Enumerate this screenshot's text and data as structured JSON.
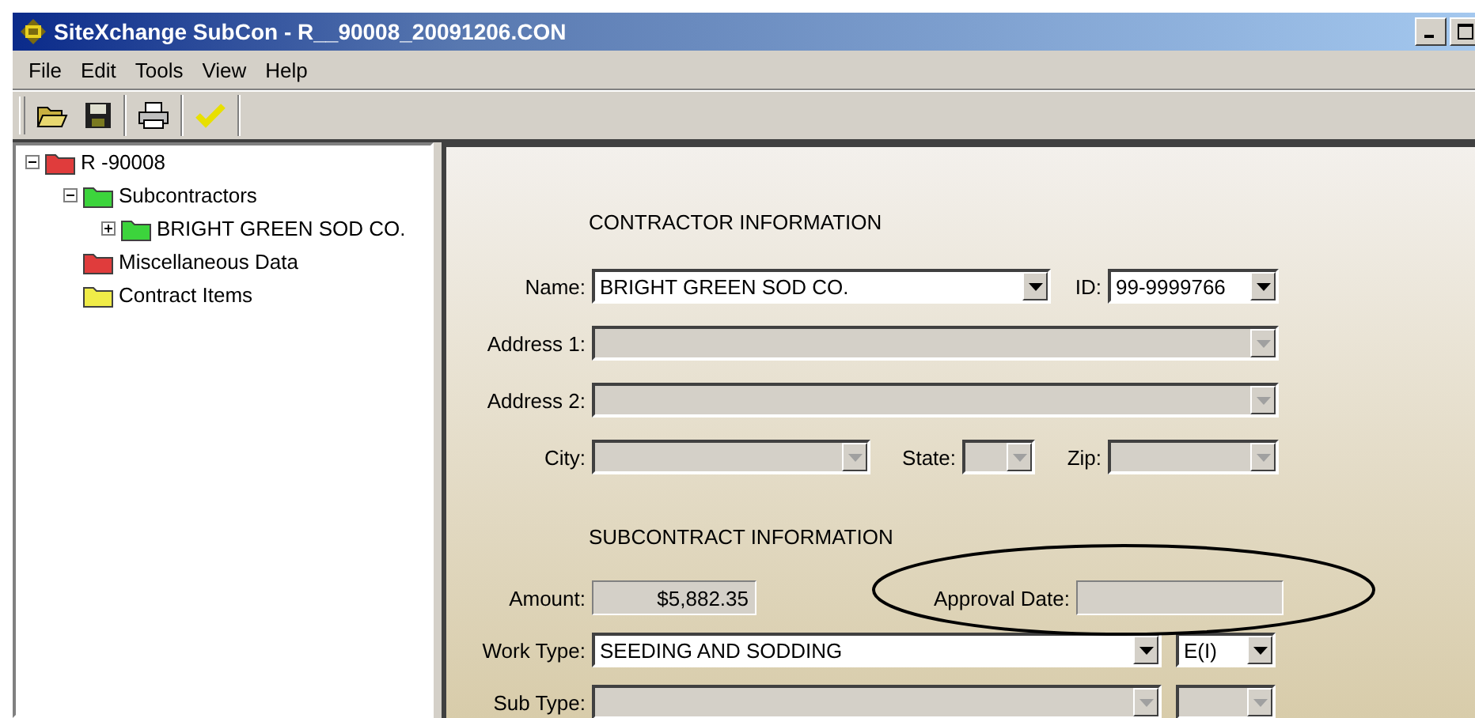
{
  "window": {
    "title": "SiteXchange SubCon - R__90008_20091206.CON"
  },
  "menu": [
    {
      "label": "File"
    },
    {
      "label": "Edit"
    },
    {
      "label": "Tools"
    },
    {
      "label": "View"
    },
    {
      "label": "Help"
    }
  ],
  "tree": [
    {
      "label": "R -90008",
      "color": "#e03c3c",
      "expanded": true,
      "children": [
        {
          "label": "Subcontractors",
          "color": "#3cd43c",
          "expanded": true,
          "children": [
            {
              "label": "BRIGHT GREEN SOD CO.",
              "color": "#3cd43c",
              "expanded": false
            }
          ]
        },
        {
          "label": "Miscellaneous Data",
          "color": "#e03c3c"
        },
        {
          "label": "Contract Items",
          "color": "#f0ec48"
        }
      ]
    }
  ],
  "contractor": {
    "title": "CONTRACTOR INFORMATION",
    "name": {
      "label": "Name:",
      "value": "BRIGHT GREEN SOD CO.",
      "disabled": false
    },
    "id": {
      "label": "ID:",
      "value": "99-9999766",
      "disabled": false
    },
    "address_1": {
      "label": "Address 1:",
      "disabled": true
    },
    "address_2": {
      "label": "Address 2:",
      "disabled": true
    },
    "city": {
      "label": "City:",
      "disabled": true
    },
    "state": {
      "label": "State:",
      "disabled": true
    },
    "zip": {
      "label": "Zip:",
      "disabled": true
    }
  },
  "subcontract": {
    "title": "SUBCONTRACT INFORMATION",
    "amount": {
      "label": "Amount:",
      "value": "$5,882.35"
    },
    "approval_date": {
      "label": "Approval Date:"
    },
    "work_type": {
      "label": "Work Type:",
      "value": "SEEDING AND SODDING",
      "disabled": false
    },
    "work_type_code": {
      "value": "E(I)",
      "disabled": false
    },
    "sub_type": {
      "label": "Sub Type:",
      "disabled": true
    },
    "sub_type_code": {
      "disabled": true
    }
  }
}
